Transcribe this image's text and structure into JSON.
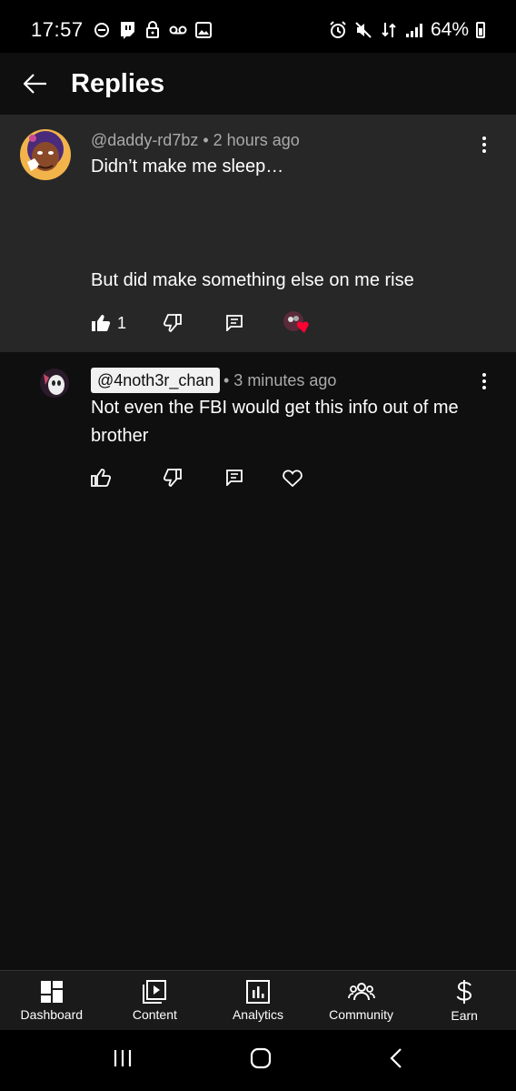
{
  "status_bar": {
    "time": "17:57",
    "battery": "64%",
    "icons_left": [
      "do-not-disturb-icon",
      "twitch-icon",
      "lock-icon",
      "voicemail-icon",
      "gallery-icon"
    ],
    "icons_right": [
      "alarm-icon",
      "mute-icon",
      "data-icon",
      "signal-icon"
    ]
  },
  "header": {
    "title": "Replies"
  },
  "parent_comment": {
    "author": "@daddy-rd7bz",
    "time": "• 2 hours ago",
    "text_line1": "Didn’t make me sleep…",
    "text_line2": "But did make something else on me rise",
    "likes": "1",
    "liked": true,
    "creator_hearted": true
  },
  "reply": {
    "author": "@4noth3r_chan",
    "time": "• 3 minutes ago",
    "text": "Not even the FBI would get this info out of me brother"
  },
  "bottom_nav": {
    "items": [
      {
        "label": "Dashboard",
        "icon": "dashboard-icon"
      },
      {
        "label": "Content",
        "icon": "content-icon"
      },
      {
        "label": "Analytics",
        "icon": "analytics-icon"
      },
      {
        "label": "Community",
        "icon": "community-icon"
      },
      {
        "label": "Earn",
        "icon": "earn-icon"
      }
    ]
  },
  "colors": {
    "background": "#0f0f0f",
    "highlight_row": "#272727",
    "secondary_text": "#aaaaaa",
    "heart": "#ff0033"
  }
}
